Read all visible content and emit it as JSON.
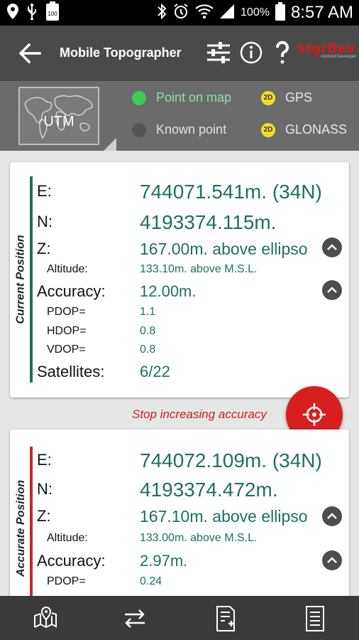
{
  "status_bar": {
    "time": "8:57 AM",
    "battery_percent": "100%",
    "left_icons": [
      "location-icon",
      "usb-icon",
      "battery-100-icon"
    ],
    "right_icons": [
      "bluetooth-icon",
      "alarm-icon",
      "wifi-icon",
      "signal-icon",
      "battery-icon"
    ]
  },
  "app_bar": {
    "title": "Mobile Topographer",
    "logo": "StgrDev",
    "logo_sub": "Android Developer",
    "actions": [
      "settings-sliders-icon",
      "info-icon",
      "help-icon"
    ]
  },
  "mode_bar": {
    "projection": "UTM",
    "point_on_map": "Point on map",
    "known_point": "Known point",
    "selected_mode": "Point on map",
    "gps": {
      "badge": "2D",
      "label": "GPS"
    },
    "glonass": {
      "badge": "2D",
      "label": "GLONASS"
    },
    "colors": {
      "active": "#3ecb57",
      "active_text": "#8ee0a0",
      "inactive": "#555555",
      "inactive_text": "#e0e0e0"
    }
  },
  "current_position": {
    "section_label": "Current Position",
    "accent_color": "#1e6f63",
    "E_label": "E:",
    "E": "744071.541m. (34N)",
    "N_label": "N:",
    "N": "4193374.115m.",
    "Z_label": "Z:",
    "Z": "167.00m. above ellipso",
    "altitude_label": "Altitude:",
    "altitude": "133.10m. above M.S.L.",
    "accuracy_label": "Accuracy:",
    "accuracy": "12.00m.",
    "pdop_label": "PDOP=",
    "pdop": "1.1",
    "hdop_label": "HDOP=",
    "hdop": "0.8",
    "vdop_label": "VDOP=",
    "vdop": "0.8",
    "satellites_label": "Satellites:",
    "satellites": "6/22"
  },
  "stop_button_text": "Stop increasing accuracy",
  "accurate_position": {
    "section_label": "Accurate Position",
    "accent_color": "#c62828",
    "E_label": "E:",
    "E": "744072.109m. (34N)",
    "N_label": "N:",
    "N": "4193374.472m.",
    "Z_label": "Z:",
    "Z": "167.10m. above ellipso",
    "altitude_label": "Altitude:",
    "altitude": "133.00m. above M.S.L.",
    "accuracy_label": "Accuracy:",
    "accuracy": "2.97m.",
    "pdop_label": "PDOP=",
    "pdop": "0.24"
  },
  "bottom_bar": [
    "map-pin-icon",
    "swap-arrows-icon",
    "add-note-icon",
    "list-document-icon"
  ]
}
